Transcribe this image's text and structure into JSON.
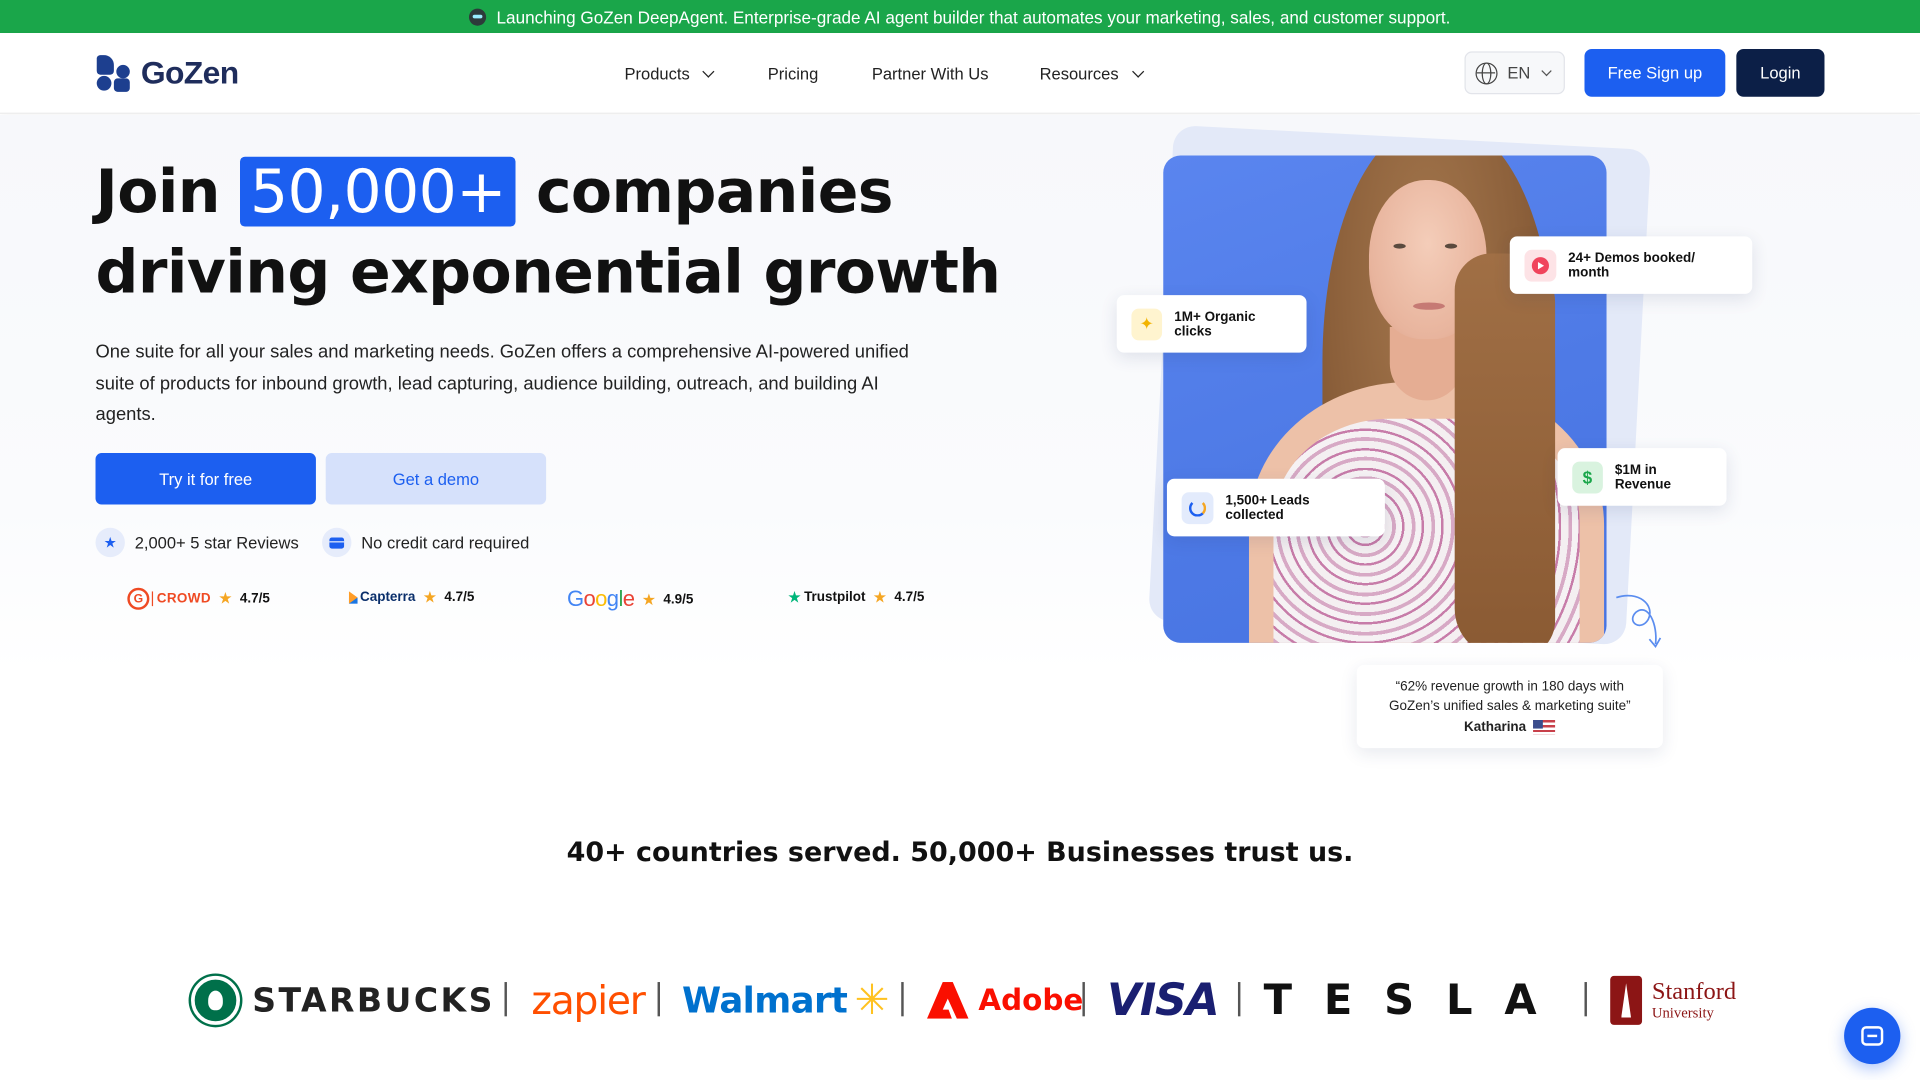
{
  "announcement": {
    "icon": "robot-icon",
    "text": "Launching GoZen DeepAgent. Enterprise-grade AI agent builder that automates your marketing, sales, and customer support."
  },
  "nav": {
    "logo_text": "GoZen",
    "items": [
      {
        "label": "Products",
        "has_dropdown": true
      },
      {
        "label": "Pricing",
        "has_dropdown": false
      },
      {
        "label": "Partner With Us",
        "has_dropdown": false
      },
      {
        "label": "Resources",
        "has_dropdown": true
      }
    ],
    "language": "EN",
    "signup_label": "Free Sign up",
    "login_label": "Login"
  },
  "hero": {
    "title_before": "Join",
    "title_highlight": "50,000+",
    "title_after": "companies",
    "title_line2": "driving exponential growth",
    "description": "One suite for all your sales and marketing needs. GoZen offers a comprehensive AI-powered unified suite of products for inbound growth, lead capturing, audience building, outreach, and building AI agents.",
    "cta_primary": "Try it for free",
    "cta_secondary": "Get a demo",
    "perks": [
      {
        "icon": "star-icon",
        "text": "2,000+ 5 star Reviews"
      },
      {
        "icon": "credit-card-icon",
        "text": "No credit card required"
      }
    ],
    "ratings": [
      {
        "source": "G2 CROWD",
        "score": "4.7/5"
      },
      {
        "source": "Capterra",
        "score": "4.7/5"
      },
      {
        "source": "Google",
        "score": "4.9/5"
      },
      {
        "source": "Trustpilot",
        "score": "4.7/5"
      }
    ],
    "stats": [
      {
        "icon": "play-icon",
        "text": "24+ Demos booked/ month"
      },
      {
        "icon": "sparkle-icon",
        "text": "1M+ Organic clicks"
      },
      {
        "icon": "dollar-icon",
        "text": "$1M in Revenue"
      },
      {
        "icon": "refresh-icon",
        "text": "1,500+ Leads collected"
      }
    ],
    "testimonial": {
      "quote": "“62% revenue growth in 180 days with GoZen’s unified sales & marketing suite”",
      "author": "Katharina"
    }
  },
  "trust": {
    "headline": "40+ countries served. 50,000+ Businesses trust us.",
    "logos": [
      "STARBUCKS",
      "zapier",
      "Walmart",
      "Adobe",
      "VISA",
      "TESLA",
      "Stanford",
      "University"
    ]
  },
  "colors": {
    "announcement_bg": "#1aa64a",
    "primary": "#1c5ff0",
    "dark_navy": "#0c1f47",
    "secondary_bg": "#d6e1fb"
  }
}
